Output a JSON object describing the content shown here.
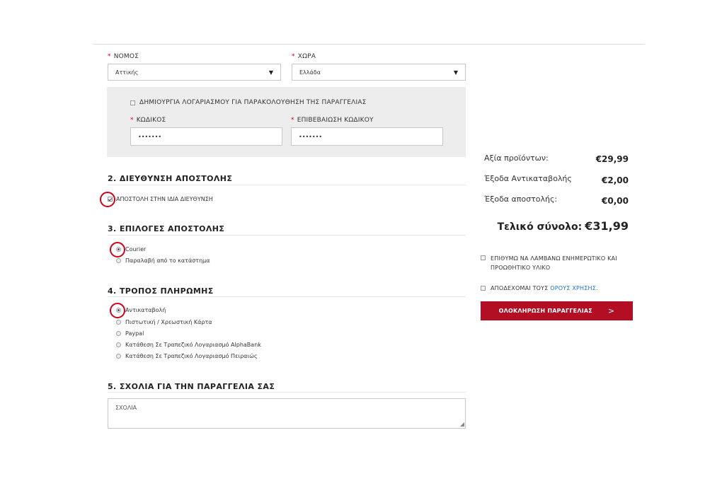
{
  "address": {
    "nomos_label": "ΝΟΜΟΣ",
    "nomos_value": "Αττικής",
    "xora_label": "ΧΩΡΑ",
    "xora_value": "Ελλάδα",
    "required_mark": "*"
  },
  "account": {
    "create_label": "ΔΗΜΙΟΥΡΓΙΑ ΛΟΓΑΡΙΑΣΜΟΥ ΓΙΑ ΠΑΡΑΚΟΛΟΥΘΗΣΗ ΤΗΣ ΠΑΡΑΓΓΕΛΙΑΣ",
    "create_checked": false,
    "password_label": "ΚΩΔΙΚΟΣ",
    "password_value": "•••••••",
    "confirm_label": "ΕΠΙΒΕΒΑΙΩΣΗ ΚΩΔΙΚΟΥ",
    "confirm_value": "•••••••"
  },
  "shipping_address": {
    "title": "2. ΔΙΕΥΘΥΝΣΗ ΑΠΟΣΤΟΛΗΣ",
    "same_address_label": "ΑΠΟΣΤΟΛΗ ΣΤΗΝ ΙΔΙΑ ΔΙΕΥΘΥΝΣΗ",
    "same_address_checked": true
  },
  "shipping_options": {
    "title": "3. ΕΠΙΛΟΓΕΣ ΑΠΟΣΤΟΛΗΣ",
    "options": [
      "Courier",
      "Παραλαβή από το κατάστημα"
    ],
    "selected": "Courier"
  },
  "payment": {
    "title": "4. ΤΡΟΠΟΣ ΠΛΗΡΩΜΗΣ",
    "options": [
      "Αντικαταβολή",
      "Πιστωτική / Χρεωστική Κάρτα",
      "Paypal",
      "Κατάθεση Σε Τραπεζικό Λογαριασμό AlphaBank",
      "Κατάθεση Σε Τραπεζικό Λογαριασμό Πειραιώς"
    ],
    "selected": "Αντικαταβολή"
  },
  "comments": {
    "title": "5. ΣΧΟΛΙΑ ΓΙΑ ΤΗΝ ΠΑΡΑΓΓΕΛΙΑ ΣΑΣ",
    "placeholder": "ΣΧΟΛΙΑ"
  },
  "summary": {
    "products_label": "Αξία προϊόντων:",
    "products_value": "€29,99",
    "cod_label": "Έξοδα Αντικαταβολής",
    "cod_value": "€2,00",
    "shipping_label": "Έξοδα αποστολής:",
    "shipping_value": "€0,00",
    "total_label": "Τελικό σύνολο:",
    "total_value": "€31,99",
    "newsletter_label": "ΕΠΙΘΥΜΩ ΝΑ ΛΑΜΒΑΝΩ ΕΝΗΜΕΡΩΤΙΚΟ ΚΑΙ ΠΡΟΩΘΗΤΙΚΟ ΥΛΙΚΟ",
    "terms_prefix": "ΑΠΟΔΕΧΟΜΑΙ ΤΟΥΣ",
    "terms_link": "ΟΡΟΥΣ ΧΡΗΣΗΣ.",
    "submit_label": "ΟΛΟΚΛΗΡΩΣΗ ΠΑΡΑΓΓΕΛΙΑΣ",
    "submit_icon": ">"
  },
  "colors": {
    "accent": "#b20e24",
    "required": "#d0021b",
    "highlight_circle": "#d0021b",
    "link": "#1a73c6"
  }
}
